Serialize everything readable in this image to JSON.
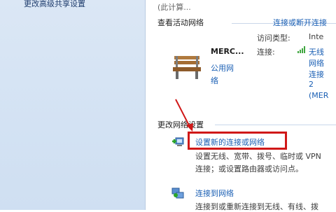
{
  "sidebar": {
    "link_text": "更改高级共享设置"
  },
  "header": {
    "partial_text": "(此计算..."
  },
  "active_networks": {
    "title": "查看活动网络",
    "link": "连接或断开连接",
    "network": {
      "name": "MERC...",
      "type_lines": [
        "公用网",
        "络"
      ]
    },
    "access_type": {
      "label": "访问类型:",
      "value": "Inte"
    },
    "connections": {
      "label": "连接:",
      "value_lines": [
        "无线",
        "网络",
        "连接",
        "2",
        "(MER"
      ]
    }
  },
  "change_settings": {
    "title": "更改网络设置",
    "items": [
      {
        "link": "设置新的连接或网络",
        "desc_lines": [
          "设置无线、宽带、拨号、临时或 VPN",
          "连接；或设置路由器或访问点。"
        ]
      },
      {
        "link": "连接到网络",
        "desc_lines": [
          "连接到或重新连接到无线、有线、拨"
        ]
      }
    ]
  },
  "colors": {
    "link": "#1a5fb4",
    "highlight_box": "#d01818"
  },
  "icons": [
    "bench-icon",
    "signal-bars-icon",
    "network-setup-icon",
    "connect-network-icon",
    "arrow-annotation"
  ]
}
